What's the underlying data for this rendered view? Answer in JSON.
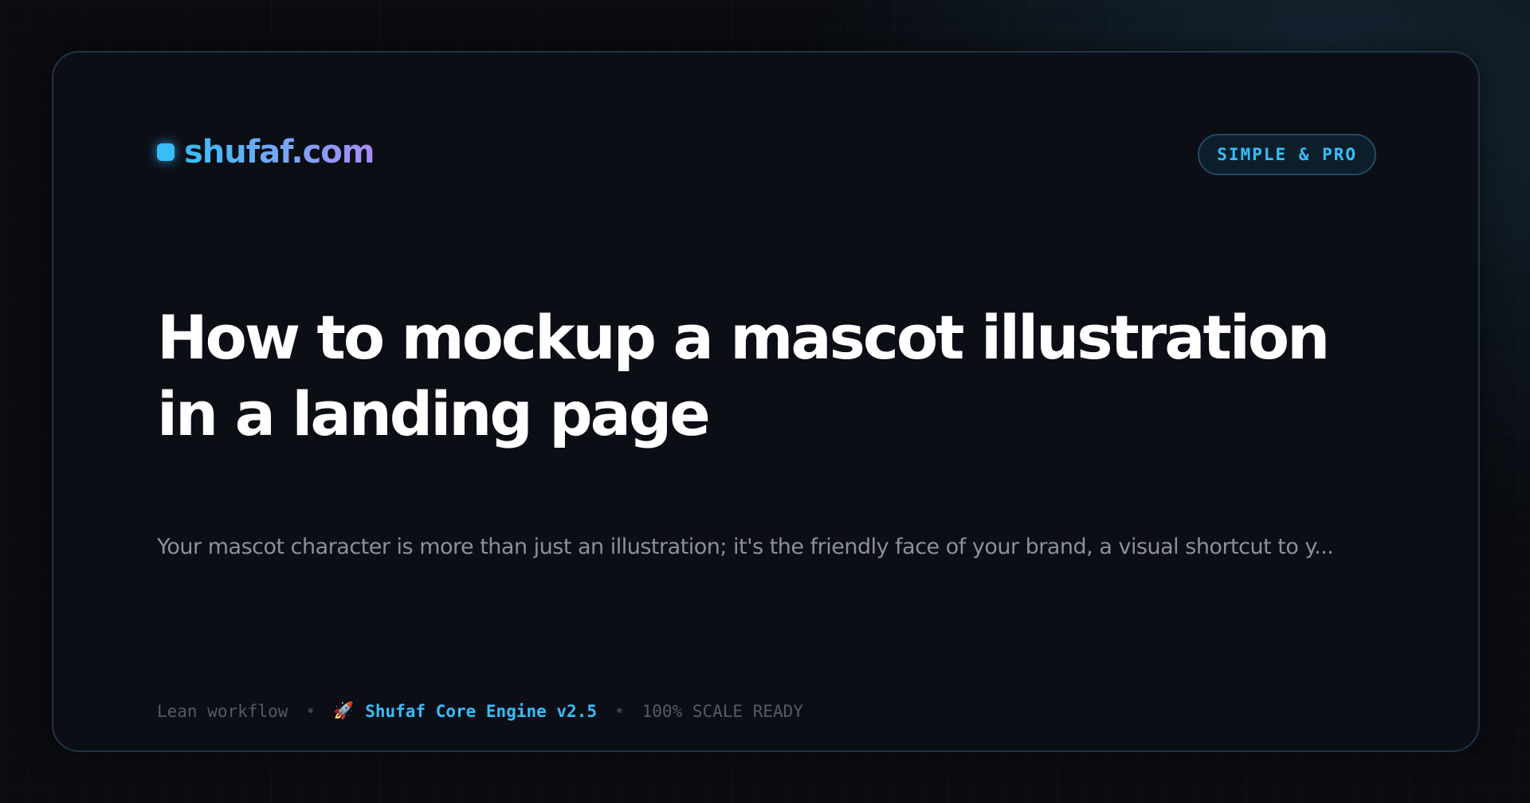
{
  "brand": {
    "name": "shufaf.com",
    "accent": "#38bdf8",
    "gradient_end": "#a78bfa"
  },
  "badge": {
    "label": "SIMPLE & PRO"
  },
  "article": {
    "title": "How to mockup a mascot illustration in a landing page",
    "excerpt": "Your mascot character is more than just an illustration; it's the friendly face of your brand, a visual shortcut to y..."
  },
  "meta": {
    "workflow": "Lean workflow",
    "separator": "•",
    "rocket_icon": "🚀",
    "engine": "Shufaf Core Engine v2.5",
    "scale": "100% SCALE READY"
  }
}
